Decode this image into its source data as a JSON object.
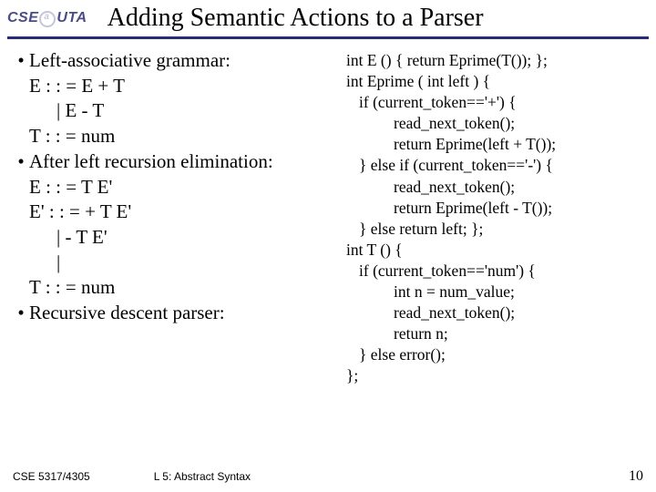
{
  "logo": {
    "cse": "CSE",
    "uta": "UTA"
  },
  "title": "Adding Semantic Actions to a Parser",
  "left": {
    "b1": "Left-associative grammar:",
    "l1": "E : : = E + T",
    "l2": "| E - T",
    "l3": "T : : = num",
    "b2": "After left recursion elimination:",
    "l4": "E : : = T E'",
    "l5": "E' : : = + T E'",
    "l6": "| - T E'",
    "l7": "|",
    "l8": "T : : = num",
    "b3": "Recursive descent parser:"
  },
  "right": {
    "r1": "int E () { return Eprime(T()); };",
    "r2": "int Eprime ( int left ) {",
    "r3": "if (current_token=='+') {",
    "r4": "read_next_token();",
    "r5": "return Eprime(left + T());",
    "r6": "} else if (current_token=='-') {",
    "r7": "read_next_token();",
    "r8": "return Eprime(left - T());",
    "r9": "} else return left;  };",
    "r10": "int T () {",
    "r11": "if (current_token=='num') {",
    "r12": "int n = num_value;",
    "r13": "read_next_token();",
    "r14": "return n;",
    "r15": "} else error();",
    "r16": "};"
  },
  "footer": {
    "left": "CSE 5317/4305",
    "mid": "L 5: Abstract Syntax",
    "page": "10"
  }
}
